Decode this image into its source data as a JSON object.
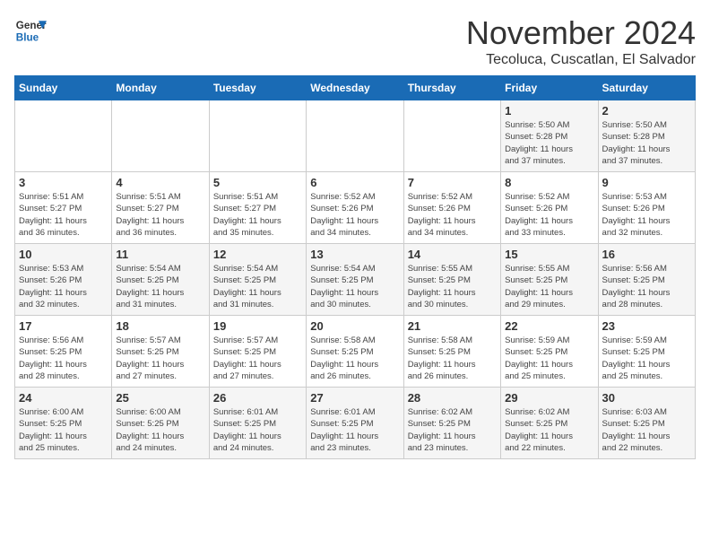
{
  "logo": {
    "line1": "General",
    "line2": "Blue"
  },
  "title": "November 2024",
  "location": "Tecoluca, Cuscatlan, El Salvador",
  "weekdays": [
    "Sunday",
    "Monday",
    "Tuesday",
    "Wednesday",
    "Thursday",
    "Friday",
    "Saturday"
  ],
  "weeks": [
    [
      {
        "day": "",
        "info": ""
      },
      {
        "day": "",
        "info": ""
      },
      {
        "day": "",
        "info": ""
      },
      {
        "day": "",
        "info": ""
      },
      {
        "day": "",
        "info": ""
      },
      {
        "day": "1",
        "info": "Sunrise: 5:50 AM\nSunset: 5:28 PM\nDaylight: 11 hours\nand 37 minutes."
      },
      {
        "day": "2",
        "info": "Sunrise: 5:50 AM\nSunset: 5:28 PM\nDaylight: 11 hours\nand 37 minutes."
      }
    ],
    [
      {
        "day": "3",
        "info": "Sunrise: 5:51 AM\nSunset: 5:27 PM\nDaylight: 11 hours\nand 36 minutes."
      },
      {
        "day": "4",
        "info": "Sunrise: 5:51 AM\nSunset: 5:27 PM\nDaylight: 11 hours\nand 36 minutes."
      },
      {
        "day": "5",
        "info": "Sunrise: 5:51 AM\nSunset: 5:27 PM\nDaylight: 11 hours\nand 35 minutes."
      },
      {
        "day": "6",
        "info": "Sunrise: 5:52 AM\nSunset: 5:26 PM\nDaylight: 11 hours\nand 34 minutes."
      },
      {
        "day": "7",
        "info": "Sunrise: 5:52 AM\nSunset: 5:26 PM\nDaylight: 11 hours\nand 34 minutes."
      },
      {
        "day": "8",
        "info": "Sunrise: 5:52 AM\nSunset: 5:26 PM\nDaylight: 11 hours\nand 33 minutes."
      },
      {
        "day": "9",
        "info": "Sunrise: 5:53 AM\nSunset: 5:26 PM\nDaylight: 11 hours\nand 32 minutes."
      }
    ],
    [
      {
        "day": "10",
        "info": "Sunrise: 5:53 AM\nSunset: 5:26 PM\nDaylight: 11 hours\nand 32 minutes."
      },
      {
        "day": "11",
        "info": "Sunrise: 5:54 AM\nSunset: 5:25 PM\nDaylight: 11 hours\nand 31 minutes."
      },
      {
        "day": "12",
        "info": "Sunrise: 5:54 AM\nSunset: 5:25 PM\nDaylight: 11 hours\nand 31 minutes."
      },
      {
        "day": "13",
        "info": "Sunrise: 5:54 AM\nSunset: 5:25 PM\nDaylight: 11 hours\nand 30 minutes."
      },
      {
        "day": "14",
        "info": "Sunrise: 5:55 AM\nSunset: 5:25 PM\nDaylight: 11 hours\nand 30 minutes."
      },
      {
        "day": "15",
        "info": "Sunrise: 5:55 AM\nSunset: 5:25 PM\nDaylight: 11 hours\nand 29 minutes."
      },
      {
        "day": "16",
        "info": "Sunrise: 5:56 AM\nSunset: 5:25 PM\nDaylight: 11 hours\nand 28 minutes."
      }
    ],
    [
      {
        "day": "17",
        "info": "Sunrise: 5:56 AM\nSunset: 5:25 PM\nDaylight: 11 hours\nand 28 minutes."
      },
      {
        "day": "18",
        "info": "Sunrise: 5:57 AM\nSunset: 5:25 PM\nDaylight: 11 hours\nand 27 minutes."
      },
      {
        "day": "19",
        "info": "Sunrise: 5:57 AM\nSunset: 5:25 PM\nDaylight: 11 hours\nand 27 minutes."
      },
      {
        "day": "20",
        "info": "Sunrise: 5:58 AM\nSunset: 5:25 PM\nDaylight: 11 hours\nand 26 minutes."
      },
      {
        "day": "21",
        "info": "Sunrise: 5:58 AM\nSunset: 5:25 PM\nDaylight: 11 hours\nand 26 minutes."
      },
      {
        "day": "22",
        "info": "Sunrise: 5:59 AM\nSunset: 5:25 PM\nDaylight: 11 hours\nand 25 minutes."
      },
      {
        "day": "23",
        "info": "Sunrise: 5:59 AM\nSunset: 5:25 PM\nDaylight: 11 hours\nand 25 minutes."
      }
    ],
    [
      {
        "day": "24",
        "info": "Sunrise: 6:00 AM\nSunset: 5:25 PM\nDaylight: 11 hours\nand 25 minutes."
      },
      {
        "day": "25",
        "info": "Sunrise: 6:00 AM\nSunset: 5:25 PM\nDaylight: 11 hours\nand 24 minutes."
      },
      {
        "day": "26",
        "info": "Sunrise: 6:01 AM\nSunset: 5:25 PM\nDaylight: 11 hours\nand 24 minutes."
      },
      {
        "day": "27",
        "info": "Sunrise: 6:01 AM\nSunset: 5:25 PM\nDaylight: 11 hours\nand 23 minutes."
      },
      {
        "day": "28",
        "info": "Sunrise: 6:02 AM\nSunset: 5:25 PM\nDaylight: 11 hours\nand 23 minutes."
      },
      {
        "day": "29",
        "info": "Sunrise: 6:02 AM\nSunset: 5:25 PM\nDaylight: 11 hours\nand 22 minutes."
      },
      {
        "day": "30",
        "info": "Sunrise: 6:03 AM\nSunset: 5:25 PM\nDaylight: 11 hours\nand 22 minutes."
      }
    ]
  ]
}
